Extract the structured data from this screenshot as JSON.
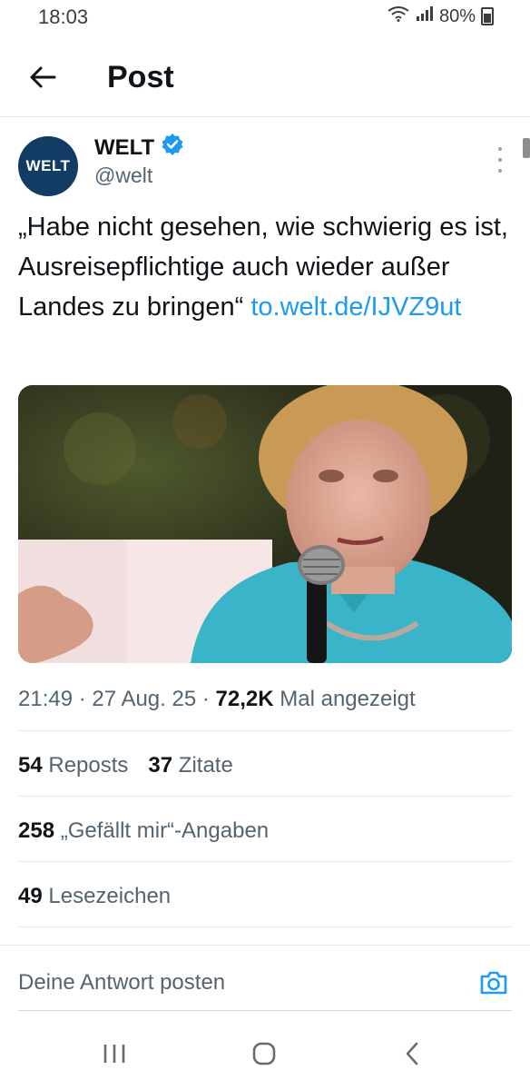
{
  "status_bar": {
    "time": "18:03",
    "battery": "80%",
    "icons": [
      "wifi-icon",
      "signal-icon",
      "battery-icon"
    ]
  },
  "header": {
    "title": "Post",
    "back_icon": "arrow-left-icon"
  },
  "author": {
    "avatar_text": "WELT",
    "name": "WELT",
    "verified": true,
    "handle": "@welt",
    "brand_color": "#123c63"
  },
  "post": {
    "text": "„Habe nicht gesehen, wie schwierig es ist, Ausreisepflichtige auch wieder außer Landes zu bringen“ ",
    "link": "to.welt.de/IJVZ9ut",
    "image": "photo-woman-speaking-into-microphone",
    "meta_time": "21:49",
    "meta_date": "27 Aug. 25",
    "views_count": "72,2K",
    "views_label": "Mal angezeigt"
  },
  "stats": {
    "reposts_count": "54",
    "reposts_label": "Reposts",
    "quotes_count": "37",
    "quotes_label": "Zitate",
    "likes_count": "258",
    "likes_label": "„Gefällt mir“-Angaben",
    "bookmarks_count": "49",
    "bookmarks_label": "Lesezeichen"
  },
  "reply": {
    "placeholder": "Deine Antwort posten",
    "camera_icon": "camera-icon"
  },
  "nav_bar": {
    "buttons": [
      "recent-apps-icon",
      "home-icon",
      "back-icon"
    ]
  },
  "colors": {
    "link": "#1d9bf0",
    "secondary_text": "#536471",
    "verified": "#1d9bf0"
  }
}
